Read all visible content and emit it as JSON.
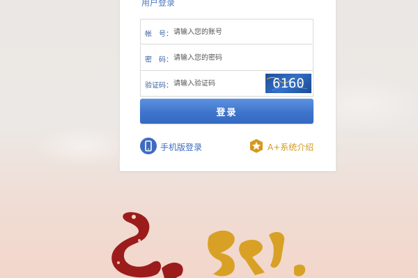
{
  "login": {
    "title": "用户登录",
    "account": {
      "label": "帐　号：",
      "placeholder": "请输入您的账号",
      "value": ""
    },
    "password": {
      "label": "密　码：",
      "placeholder": "请输入您的密码",
      "value": ""
    },
    "captcha": {
      "label": "验证码：",
      "placeholder": "请输入验证码",
      "value": "",
      "image_text": "6160"
    },
    "submit_label": "登录"
  },
  "links": {
    "mobile_label": "手机版登录",
    "about_label": "A+系统介绍"
  },
  "icons": {
    "mobile": "phone-icon",
    "about": "star-badge-icon",
    "decoration": "snake-papercut-icon"
  },
  "colors": {
    "primary": "#3f74cc",
    "link_blue": "#3e6cc0",
    "gold": "#d59a1c",
    "festive_red": "#9c1c1c"
  }
}
